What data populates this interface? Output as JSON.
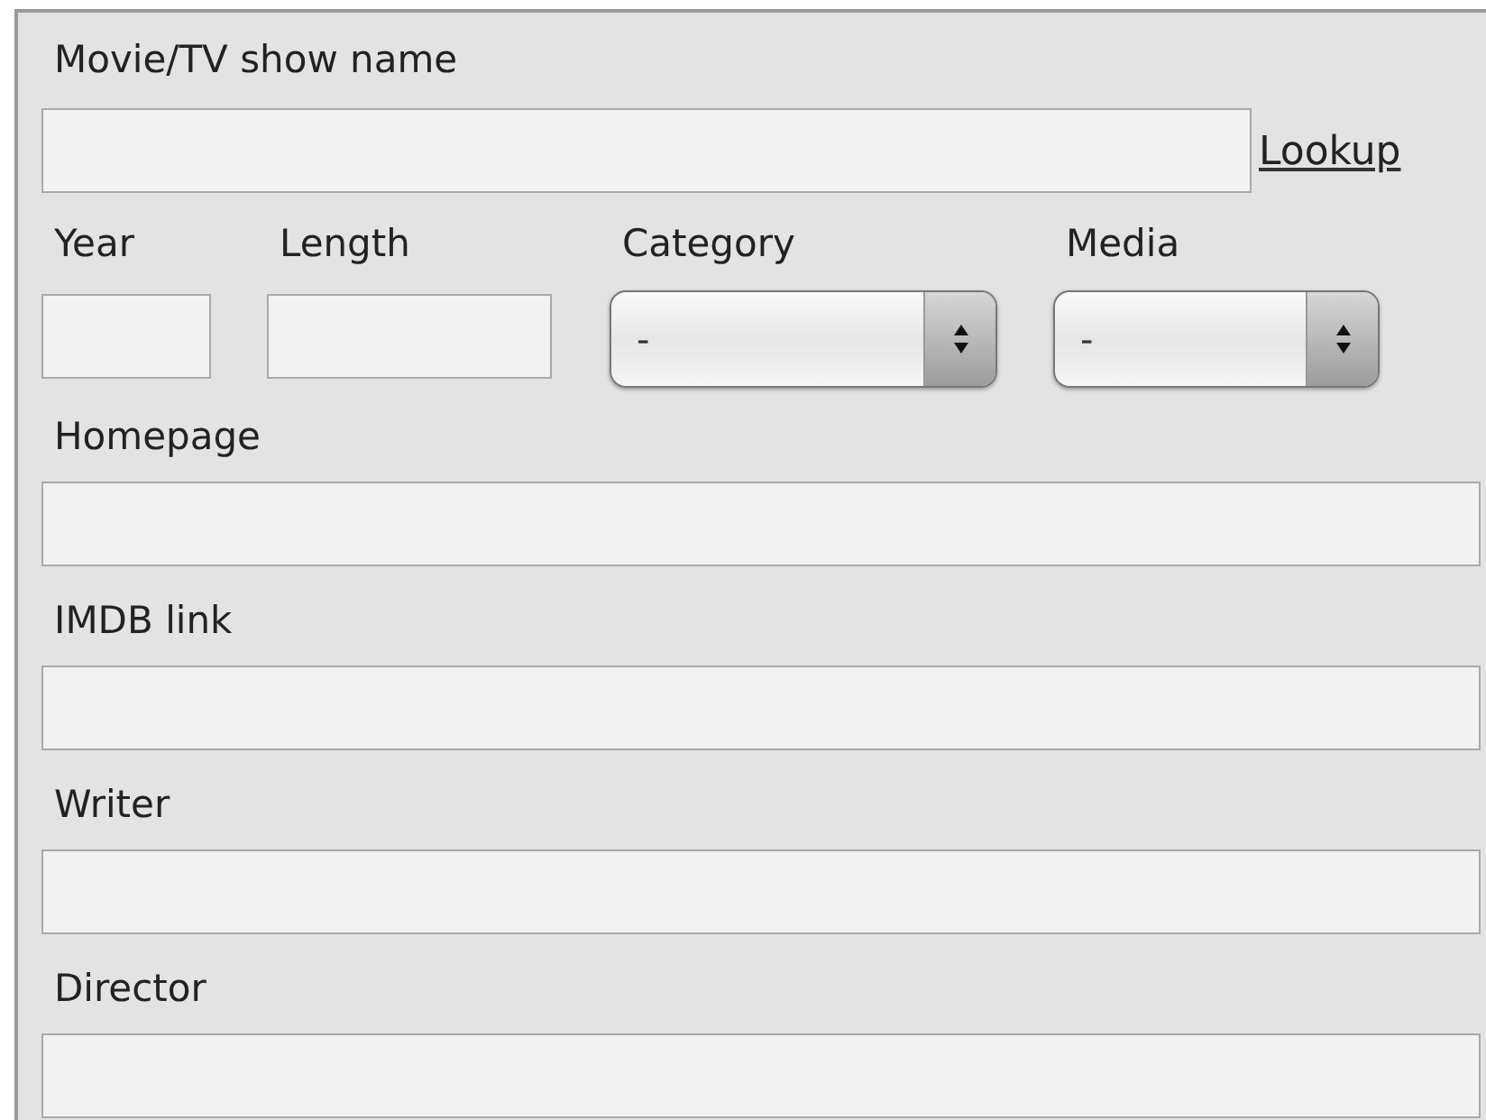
{
  "title_field": {
    "label": "Movie/TV show name",
    "link": "Lookup"
  },
  "details": [
    {
      "kind": "text",
      "label": "Year"
    },
    {
      "kind": "text",
      "label": "Length"
    },
    {
      "kind": "select",
      "label": "Category",
      "value": "-"
    },
    {
      "kind": "select",
      "label": "Media",
      "value": "-"
    }
  ],
  "fields": [
    {
      "label": "Homepage"
    },
    {
      "label": "IMDB link"
    },
    {
      "label": "Writer"
    },
    {
      "label": "Director"
    }
  ]
}
